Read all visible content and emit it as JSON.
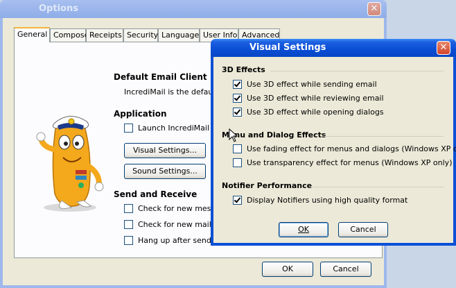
{
  "options_window": {
    "title": "Options",
    "tabs": [
      {
        "label": "General",
        "active": true
      },
      {
        "label": "Compose"
      },
      {
        "label": "Receipts"
      },
      {
        "label": "Security"
      },
      {
        "label": "Language"
      },
      {
        "label": "User Info"
      },
      {
        "label": "Advanced"
      }
    ],
    "default_email": {
      "heading": "Default Email Client",
      "text": "IncrediMail is the default em"
    },
    "application": {
      "heading": "Application",
      "launch_label": "Launch IncrediMail on",
      "launch_checked": false,
      "visual_settings_button": "Visual Settings...",
      "sound_settings_button": "Sound Settings..."
    },
    "send_receive": {
      "heading": "Send and Receive",
      "items": [
        {
          "label": "Check for new messag",
          "checked": false
        },
        {
          "label": "Check for new mail wh",
          "checked": false
        },
        {
          "label": "Hang up after sending",
          "checked": false
        }
      ]
    },
    "ok_button": "OK",
    "cancel_button": "Cancel"
  },
  "visual_dialog": {
    "title": "Visual Settings",
    "effects_3d": {
      "heading": "3D Effects",
      "items": [
        {
          "label": "Use 3D effect while sending email",
          "checked": true
        },
        {
          "label": "Use 3D effect while reviewing email",
          "checked": true
        },
        {
          "label": "Use 3D effect while opening dialogs",
          "checked": true
        }
      ]
    },
    "menu_effects": {
      "heading": "Menu and Dialog Effects",
      "items": [
        {
          "label": "Use fading effect for menus and dialogs (Windows XP only)",
          "checked": false
        },
        {
          "label": "Use transparency effect for menus (Windows XP only)",
          "checked": false
        }
      ]
    },
    "notifier": {
      "heading": "Notifier Performance",
      "items": [
        {
          "label": "Display Notifiers using high quality format",
          "checked": true
        }
      ]
    },
    "ok_button": "OK",
    "cancel_button": "Cancel"
  },
  "colors": {
    "xp_blue": "#0a4fd6",
    "dialog_bg": "#ece9d8",
    "tab_accent": "#f2b53b",
    "mascot_body": "#f4a81c"
  }
}
